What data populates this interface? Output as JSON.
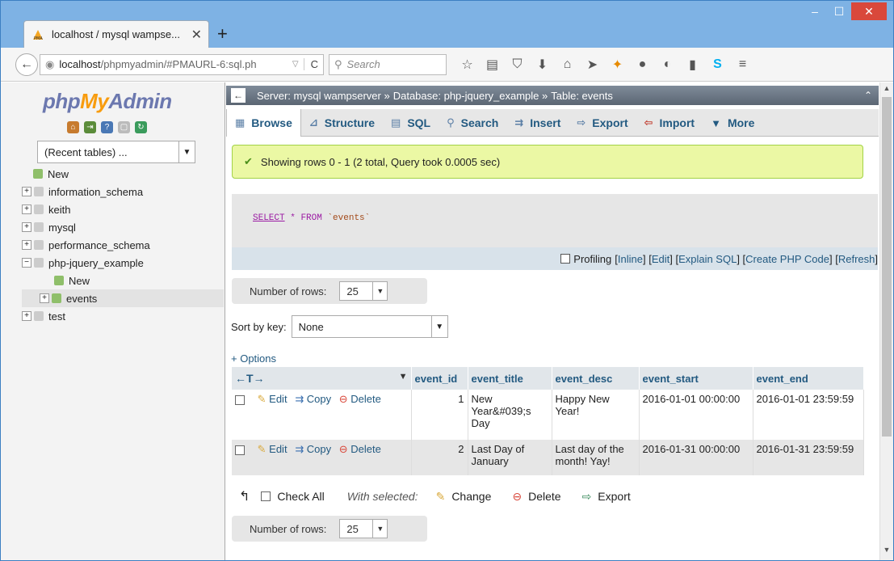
{
  "browser": {
    "tab_title": "localhost / mysql wampse...",
    "new_tab": "+",
    "url_host": "localhost",
    "url_rest": "/phpmyadmin/#PMAURL-6:sql.ph",
    "search_placeholder": "Search"
  },
  "sidebar": {
    "logo_a": "php",
    "logo_b": "My",
    "logo_c": "Admin",
    "recent": "(Recent tables) ...",
    "tree": [
      {
        "label": "New"
      },
      {
        "label": "information_schema"
      },
      {
        "label": "keith"
      },
      {
        "label": "mysql"
      },
      {
        "label": "performance_schema"
      },
      {
        "label": "php-jquery_example"
      },
      {
        "label": "New"
      },
      {
        "label": "events"
      },
      {
        "label": "test"
      }
    ]
  },
  "breadcrumb": {
    "server": "Server: mysql wampserver »",
    "database": "Database: php-jquery_example »",
    "table": "Table: events"
  },
  "tabs": [
    "Browse",
    "Structure",
    "SQL",
    "Search",
    "Insert",
    "Export",
    "Import",
    "More"
  ],
  "success": "Showing rows 0 - 1 (2 total, Query took 0.0005 sec)",
  "sql": {
    "select": "SELECT",
    "star": "*",
    "from": "FROM",
    "table": "`events`"
  },
  "sqlopts": {
    "profiling": "Profiling",
    "inline": "Inline",
    "edit": "Edit",
    "explain": "Explain SQL",
    "php": "Create PHP Code",
    "refresh": "Refresh"
  },
  "numrows": {
    "label": "Number of rows:",
    "value": "25"
  },
  "sortkey": {
    "label": "Sort by key:",
    "value": "None"
  },
  "options": "+ Options",
  "table": {
    "nav": "←T→",
    "sort_indicator": "▼",
    "columns": [
      "event_id",
      "event_title",
      "event_desc",
      "event_start",
      "event_end"
    ],
    "actions": {
      "edit": "Edit",
      "copy": "Copy",
      "delete": "Delete"
    },
    "rows": [
      {
        "id": "1",
        "title": "New Year&#039;s Day",
        "desc": "Happy New Year!",
        "start": "2016-01-01 00:00:00",
        "end": "2016-01-01 23:59:59"
      },
      {
        "id": "2",
        "title": "Last Day of January",
        "desc": "Last day of the month! Yay!",
        "start": "2016-01-31 00:00:00",
        "end": "2016-01-31 23:59:59"
      }
    ]
  },
  "footer": {
    "check_all": "Check All",
    "with_selected": "With selected:",
    "change": "Change",
    "delete": "Delete",
    "export": "Export"
  },
  "colors": {
    "link": "#235a81",
    "success_bg": "#ebf8a4",
    "close_red": "#d9483b"
  }
}
